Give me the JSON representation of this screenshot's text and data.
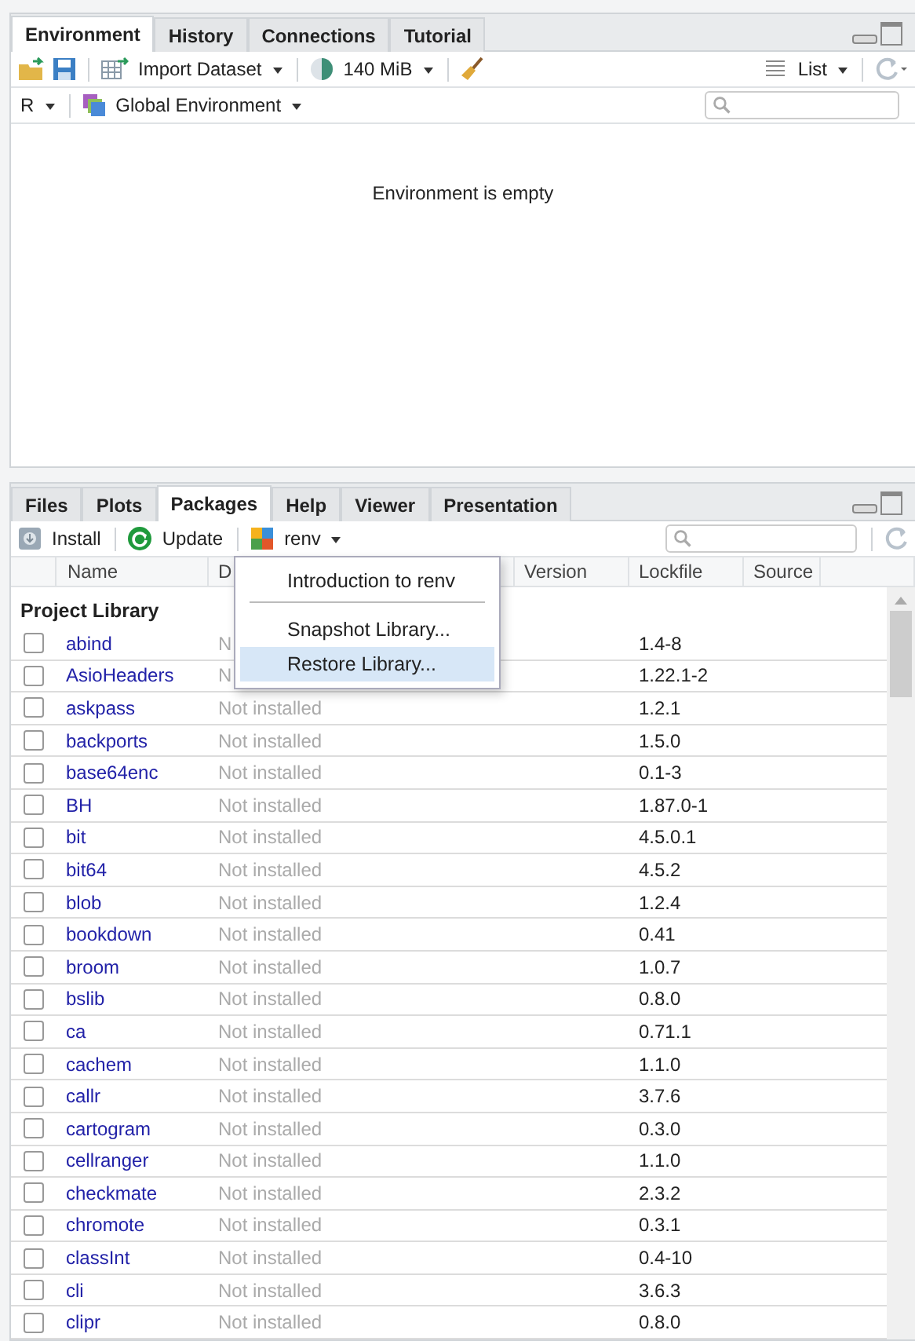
{
  "top_pane": {
    "tabs": [
      {
        "label": "Environment",
        "selected": true
      },
      {
        "label": "History",
        "selected": false
      },
      {
        "label": "Connections",
        "selected": false
      },
      {
        "label": "Tutorial",
        "selected": false
      }
    ],
    "toolbar": {
      "import": "Import Dataset",
      "memory": "140 MiB",
      "view": "List"
    },
    "env_bar": {
      "language": "R",
      "environment": "Global Environment"
    },
    "message": "Environment is empty"
  },
  "bottom_pane": {
    "tabs": [
      {
        "label": "Files",
        "selected": false
      },
      {
        "label": "Plots",
        "selected": false
      },
      {
        "label": "Packages",
        "selected": true
      },
      {
        "label": "Help",
        "selected": false
      },
      {
        "label": "Viewer",
        "selected": false
      },
      {
        "label": "Presentation",
        "selected": false
      }
    ],
    "toolbar": {
      "install": "Install",
      "update": "Update",
      "renv": "renv"
    },
    "columns": [
      "Name",
      "D",
      "Version",
      "Lockfile",
      "Source"
    ],
    "section": "Project Library",
    "rows": [
      {
        "name": "abind",
        "description": "N",
        "lockfile": "1.4-8",
        "checked": false
      },
      {
        "name": "AsioHeaders",
        "description": "N",
        "lockfile": "1.22.1-2",
        "checked": false
      },
      {
        "name": "askpass",
        "description": "Not installed",
        "lockfile": "1.2.1",
        "checked": false
      },
      {
        "name": "backports",
        "description": "Not installed",
        "lockfile": "1.5.0",
        "checked": false
      },
      {
        "name": "base64enc",
        "description": "Not installed",
        "lockfile": "0.1-3",
        "checked": false
      },
      {
        "name": "BH",
        "description": "Not installed",
        "lockfile": "1.87.0-1",
        "checked": false
      },
      {
        "name": "bit",
        "description": "Not installed",
        "lockfile": "4.5.0.1",
        "checked": false
      },
      {
        "name": "bit64",
        "description": "Not installed",
        "lockfile": "4.5.2",
        "checked": false
      },
      {
        "name": "blob",
        "description": "Not installed",
        "lockfile": "1.2.4",
        "checked": false
      },
      {
        "name": "bookdown",
        "description": "Not installed",
        "lockfile": "0.41",
        "checked": false
      },
      {
        "name": "broom",
        "description": "Not installed",
        "lockfile": "1.0.7",
        "checked": false
      },
      {
        "name": "bslib",
        "description": "Not installed",
        "lockfile": "0.8.0",
        "checked": false
      },
      {
        "name": "ca",
        "description": "Not installed",
        "lockfile": "0.71.1",
        "checked": false
      },
      {
        "name": "cachem",
        "description": "Not installed",
        "lockfile": "1.1.0",
        "checked": false
      },
      {
        "name": "callr",
        "description": "Not installed",
        "lockfile": "3.7.6",
        "checked": false
      },
      {
        "name": "cartogram",
        "description": "Not installed",
        "lockfile": "0.3.0",
        "checked": false
      },
      {
        "name": "cellranger",
        "description": "Not installed",
        "lockfile": "1.1.0",
        "checked": false
      },
      {
        "name": "checkmate",
        "description": "Not installed",
        "lockfile": "2.3.2",
        "checked": false
      },
      {
        "name": "chromote",
        "description": "Not installed",
        "lockfile": "0.3.1",
        "checked": false
      },
      {
        "name": "classInt",
        "description": "Not installed",
        "lockfile": "0.4-10",
        "checked": false
      },
      {
        "name": "cli",
        "description": "Not installed",
        "lockfile": "3.6.3",
        "checked": false
      },
      {
        "name": "clipr",
        "description": "Not installed",
        "lockfile": "0.8.0",
        "checked": false
      }
    ],
    "menu": [
      {
        "kind": "item",
        "label": "Introduction to renv",
        "selected": false
      },
      {
        "kind": "separator"
      },
      {
        "kind": "item",
        "label": "Snapshot Library...",
        "selected": false
      },
      {
        "kind": "item",
        "label": "Restore Library...",
        "selected": true
      }
    ]
  }
}
